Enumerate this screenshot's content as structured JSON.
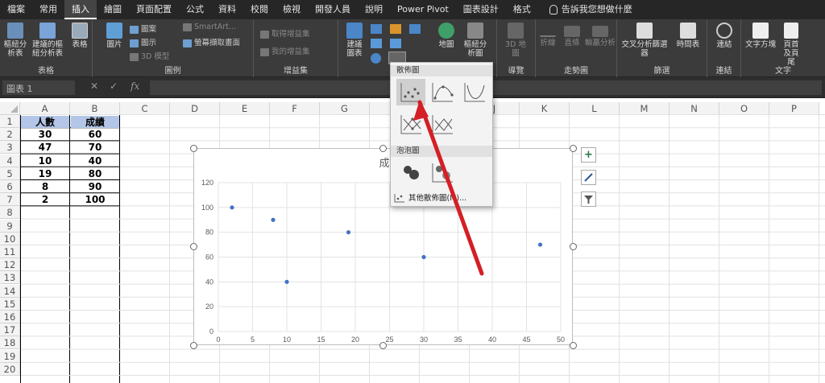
{
  "tabs": [
    "檔案",
    "常用",
    "插入",
    "繪圖",
    "頁面配置",
    "公式",
    "資料",
    "校閱",
    "檢視",
    "開發人員",
    "說明",
    "Power Pivot",
    "圖表設計",
    "格式"
  ],
  "active_tab": "插入",
  "tell_me": "告訴我您想做什麼",
  "ribbon": {
    "groups": [
      "表格",
      "圖例",
      "增益集",
      "圖表",
      "導覽",
      "走勢圖",
      "篩選",
      "連結",
      "文字"
    ],
    "pivot_table": "樞紐分析表",
    "recommended_pivot": "建議的樞紐分析表",
    "table": "表格",
    "pictures": "圖片",
    "shapes": "圖案",
    "icons": "圖示",
    "models_3d": "3D 模型",
    "smartart": "SmartArt...",
    "screenshot": "螢幕擷取畫面",
    "get_addins": "取得增益集",
    "my_addins": "我的增益集",
    "recommended_charts": "建議圖表",
    "maps": "地圖",
    "pivot_chart": "樞紐分析圖",
    "map_3d": "3D 地圖",
    "spark_line": "折線",
    "spark_column": "直條",
    "spark_winloss": "輸贏分析",
    "slicer": "交叉分析篩選器",
    "timeline": "時間表",
    "link": "連結",
    "textbox": "文字方塊",
    "header_footer": "頁首及頁尾"
  },
  "formula_bar": {
    "name_box": "圖表 1",
    "fx": "fx",
    "cancel": "✕",
    "enter": "✓"
  },
  "columns": [
    "A",
    "B",
    "C",
    "D",
    "E",
    "F",
    "G",
    "H",
    "I",
    "J",
    "K",
    "L",
    "M",
    "N",
    "O",
    "P"
  ],
  "rows": [
    "1",
    "2",
    "3",
    "4",
    "5",
    "6",
    "7",
    "8",
    "9",
    "10",
    "11",
    "12",
    "13",
    "14",
    "15",
    "16",
    "17",
    "18",
    "19",
    "20"
  ],
  "table": {
    "headers": [
      "人數",
      "成績"
    ],
    "rows": [
      [
        "30",
        "60"
      ],
      [
        "47",
        "70"
      ],
      [
        "10",
        "40"
      ],
      [
        "19",
        "80"
      ],
      [
        "8",
        "90"
      ],
      [
        "2",
        "100"
      ]
    ]
  },
  "chart_data": {
    "type": "scatter",
    "title": "成績",
    "x": [
      30,
      47,
      10,
      19,
      8,
      2
    ],
    "y": [
      60,
      70,
      40,
      80,
      90,
      100
    ],
    "xlim": [
      0,
      50
    ],
    "ylim": [
      0,
      120
    ],
    "x_ticks": [
      0,
      5,
      10,
      15,
      20,
      25,
      30,
      35,
      40,
      45,
      50
    ],
    "y_ticks": [
      0,
      20,
      40,
      60,
      80,
      100,
      120
    ],
    "grid": true,
    "marker_color": "#4472c4"
  },
  "dropdown": {
    "scatter_header": "散佈圖",
    "bubble_header": "泡泡圖",
    "more_label": "其他散佈圖(M)..."
  },
  "chart_side_buttons": {
    "add": "+"
  },
  "colors": {
    "ribbon": "#3b3b3b",
    "tabbar": "#262626",
    "header_fill": "#b4c6e7",
    "arrow": "#d41f25",
    "accent_green": "#217346"
  }
}
